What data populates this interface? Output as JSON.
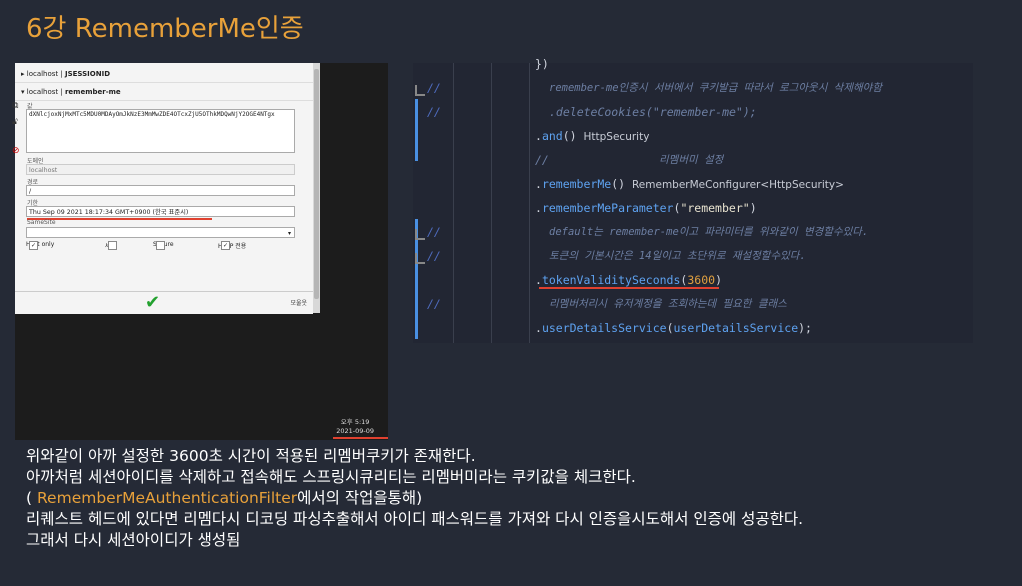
{
  "page": {
    "title": "6강 RememberMe인증"
  },
  "cookie_panel": {
    "row1": {
      "host": "localhost",
      "sep": " | ",
      "name": "JSESSIONID"
    },
    "row2": {
      "host": "localhost",
      "sep": " | ",
      "name": "remember-me"
    },
    "value_label": "값",
    "value": "dXNlcjoxNjMxMTc5MDU0MDAyOmJkNzE3MmMwZDE4OTcxZjU5OThkMDQwNjY2OGE4NTgx",
    "domain_label": "도메인",
    "domain": "localhost",
    "path_label": "경로",
    "path": "/",
    "expires_label": "기한",
    "expires": "Thu Sep 09 2021 18:17:34 GMT+0900 (한국 표준시)",
    "samesite_label": "SameSite",
    "hostonly_label": "Host only",
    "session_label": "세션",
    "secure_label": "Secure",
    "httponly_label": "HTTP 전용",
    "save_label": "모울웃",
    "colors": {
      "ok": "#23a12f",
      "underline": "#e0412f"
    }
  },
  "taskbar": {
    "time": "오후 5:19",
    "date": "2021-09-09"
  },
  "code": {
    "brace": "})",
    "l1_slash": "//",
    "l1_text": "remember-me인증시 서버에서 쿠키발급 따라서 로그아웃시 삭제해야함",
    "l2_slash": "//",
    "l2_text": ".deleteCookies(\"remember-me\");",
    "l3_pre": ".",
    "l3_fn": "and",
    "l3_paren": "()",
    "l3_hint": "HttpSecurity",
    "l4_slash": "//",
    "l4_text": "리멤버미 설정",
    "l5_pre": ".",
    "l5_fn": "rememberMe",
    "l5_paren": "()",
    "l5_hint": "RememberMeConfigurer<HttpSecurity>",
    "l6_pre": ".",
    "l6_fn": "rememberMeParameter",
    "l6_open": "(",
    "l6_str": "\"remember\"",
    "l6_close": ")",
    "l7_slash": "//",
    "l7_text": "default는 remember-me이고 파라미터를 위와같이 변경할수있다.",
    "l8_slash": "//",
    "l8_text": "토큰의 기본시간은 14일이고 초단위로 재설정할수있다.",
    "l9_pre": ".",
    "l9_fn": "tokenValiditySeconds",
    "l9_open": "(",
    "l9_num": "3600",
    "l9_close": ")",
    "l10_slash": "//",
    "l10_text": "리멤버처리시 유저계정을 조회하는데 필요한 클래스",
    "l11_pre": ".",
    "l11_fn": "userDetailsService",
    "l11_open": "(",
    "l11_arg": "userDetailsService",
    "l11_close": ");",
    "colors": {
      "comment": "#6d7fa3",
      "keyword": "#6aa6f8",
      "number": "#e0a040",
      "gutter": "#4a90e2"
    }
  },
  "description": {
    "line1": "위와같이 아까 설정한 3600초 시간이 적용된 리멤버쿠키가 존재한다.",
    "line2": "아까처럼 세션아이디를 삭제하고 접속해도 스프링시큐리티는 리멤버미라는 쿠키값을 체크한다.",
    "line3_open": "( ",
    "line3_accent": "RememberMeAuthenticationFilter",
    "line3_rest": "에서의 작업을통해)",
    "line4": "리퀘스트 헤드에 있다면 리멤다시 디코딩 파싱추출해서 아이디 패스워드를 가져와 다시 인증을시도해서 인증에 성공한다.",
    "line5": "그래서 다시 세션아이디가 생성됨",
    "accent_color": "#e8a13a"
  }
}
